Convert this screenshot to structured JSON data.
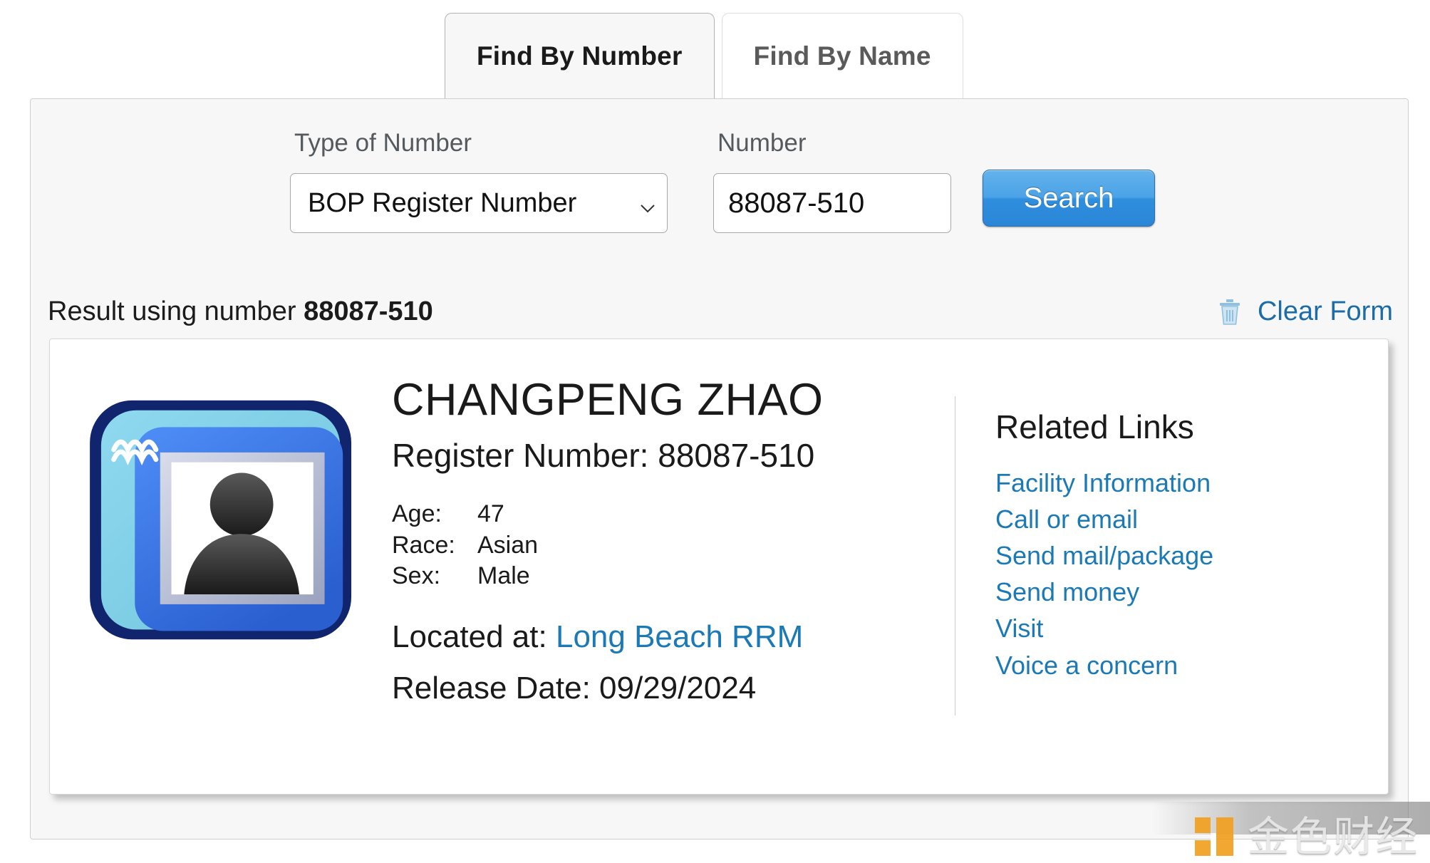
{
  "tabs": [
    {
      "label": "Find By Number",
      "active": true
    },
    {
      "label": "Find By Name",
      "active": false
    }
  ],
  "search_form": {
    "type_label": "Type of Number",
    "type_value": "BOP Register Number",
    "number_label": "Number",
    "number_value": "88087-510",
    "number_placeholder": "",
    "search_button": "Search",
    "chevron_icon": "chevron-down-icon"
  },
  "result_bar": {
    "prefix": "Result using number",
    "number": "88087-510",
    "clear_label": "Clear Form",
    "trash_icon": "trash-icon"
  },
  "result_card": {
    "photo_icon": "inmate-photo-placeholder-icon",
    "name": "CHANGPENG ZHAO",
    "register_number_line": "Register Number: 88087-510",
    "attributes": [
      {
        "key": "Age:",
        "value": "47"
      },
      {
        "key": "Race:",
        "value": "Asian"
      },
      {
        "key": "Sex:",
        "value": "Male"
      }
    ],
    "located_label": "Located at:",
    "located_value": "Long Beach RRM",
    "release_line": "Release Date: 09/29/2024"
  },
  "related_links": {
    "title": "Related Links",
    "items": [
      "Facility Information",
      "Call or email",
      "Send mail/package",
      "Send money",
      "Visit",
      "Voice a concern"
    ]
  },
  "watermark": {
    "text": "金色财经",
    "mark_icon": "jinse-logo-icon"
  },
  "colors": {
    "link": "#1b7ab5",
    "clear_link": "#1b6ca8",
    "button_blue": "#2f8ede",
    "panel_bg": "#f7f7f7",
    "watermark_orange": "#f0a020"
  }
}
